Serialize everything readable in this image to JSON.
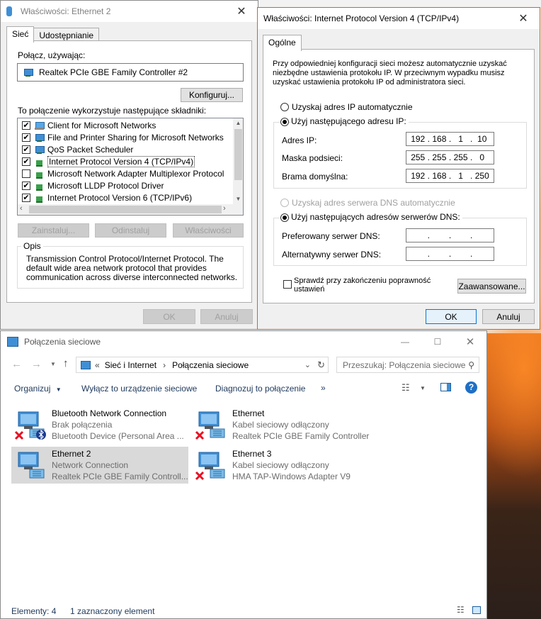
{
  "ethernet_props": {
    "title": "Właściwości: Ethernet 2",
    "tabs": [
      "Sieć",
      "Udostępnianie"
    ],
    "connect_using_label": "Połącz, używając:",
    "adapter_name": "Realtek PCIe GBE Family Controller #2",
    "configure_button": "Konfiguruj...",
    "components_label": "To połączenie wykorzystuje następujące składniki:",
    "components": [
      {
        "label": "Client for Microsoft Networks",
        "checked": true,
        "icon": "client-icon"
      },
      {
        "label": "File and Printer Sharing for Microsoft Networks",
        "checked": true,
        "icon": "network-service-icon"
      },
      {
        "label": "QoS Packet Scheduler",
        "checked": true,
        "icon": "network-service-icon"
      },
      {
        "label": "Internet Protocol Version 4 (TCP/IPv4)",
        "checked": true,
        "icon": "protocol-icon",
        "selected": true
      },
      {
        "label": "Microsoft Network Adapter Multiplexor Protocol",
        "checked": false,
        "icon": "protocol-icon"
      },
      {
        "label": "Microsoft LLDP Protocol Driver",
        "checked": true,
        "icon": "protocol-icon"
      },
      {
        "label": "Internet Protocol Version 6 (TCP/IPv6)",
        "checked": true,
        "icon": "protocol-icon"
      }
    ],
    "install_button": "Zainstaluj...",
    "uninstall_button": "Odinstaluj",
    "properties_button": "Właściwości",
    "description_title": "Opis",
    "description_text": "Transmission Control Protocol/Internet Protocol. The default wide area network protocol that provides communication across diverse interconnected networks.",
    "ok_button": "OK",
    "cancel_button": "Anuluj"
  },
  "ipv4_props": {
    "title": "Właściwości: Internet Protocol Version 4 (TCP/IPv4)",
    "tab": "Ogólne",
    "intro": "Przy odpowiedniej konfiguracji sieci możesz automatycznie uzyskać niezbędne ustawienia protokołu IP. W przeciwnym wypadku musisz uzyskać ustawienia protokołu IP od administratora sieci.",
    "auto_ip_label": "Uzyskaj adres IP automatycznie",
    "manual_ip_label": "Użyj następującego adresu IP:",
    "ip_address_label": "Adres IP:",
    "ip_address": [
      "192",
      "168",
      "1",
      "10"
    ],
    "subnet_label": "Maska podsieci:",
    "subnet": [
      "255",
      "255",
      "255",
      "0"
    ],
    "gateway_label": "Brama domyślna:",
    "gateway": [
      "192",
      "168",
      "1",
      "250"
    ],
    "auto_dns_label": "Uzyskaj adres serwera DNS automatycznie",
    "manual_dns_label": "Użyj następujących adresów serwerów DNS:",
    "preferred_dns_label": "Preferowany serwer DNS:",
    "alternate_dns_label": "Alternatywny serwer DNS:",
    "validate_label_line1": "Sprawdź przy zakończeniu poprawność",
    "validate_label_line2": "ustawień",
    "advanced_button": "Zaawansowane...",
    "ok_button": "OK",
    "cancel_button": "Anuluj"
  },
  "explorer": {
    "title": "Połączenia sieciowe",
    "breadcrumb_sep": "«",
    "breadcrumb": [
      "Sieć i Internet",
      "Połączenia sieciowe"
    ],
    "search_placeholder": "Przeszukaj: Połączenia sieciowe",
    "toolbar": {
      "organize": "Organizuj",
      "disable": "Wyłącz to urządzenie sieciowe",
      "diagnose": "Diagnozuj to połączenie",
      "more": "»"
    },
    "adapters": [
      {
        "name": "Bluetooth Network Connection",
        "status": "Brak połączenia",
        "device": "Bluetooth Device (Personal Area ..."
      },
      {
        "name": "Ethernet",
        "status": "Kabel sieciowy odłączony",
        "device": "Realtek PCIe GBE Family Controller"
      },
      {
        "name": "Ethernet 2",
        "status": "Network Connection",
        "device": "Realtek PCIe GBE Family Controll..."
      },
      {
        "name": "Ethernet 3",
        "status": "Kabel sieciowy odłączony",
        "device": "HMA TAP-Windows Adapter V9"
      }
    ],
    "status_bar": {
      "items": "Elementy: 4",
      "selected": "1 zaznaczony element"
    }
  },
  "colors": {
    "accent": "#0078d7",
    "selection": "#cce8ff",
    "disconnected_x": "#e81123"
  }
}
